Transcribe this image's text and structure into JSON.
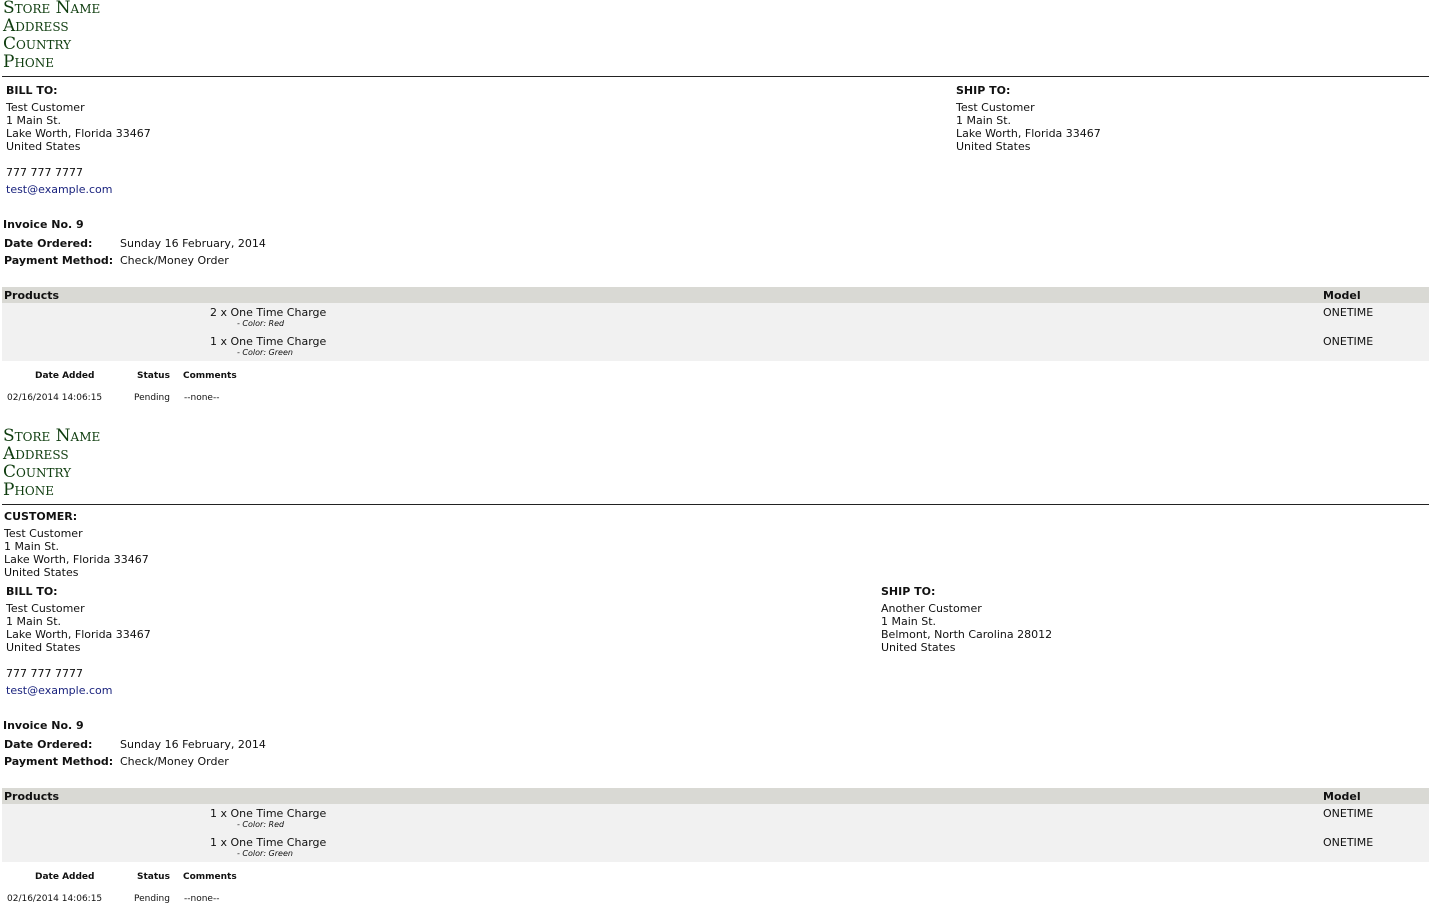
{
  "store": [
    "Store Name",
    "Address",
    "Country",
    "Phone"
  ],
  "invoices": [
    {
      "bill_to": {
        "label": "BILL TO:",
        "lines": [
          "Test Customer",
          "1 Main St.",
          "Lake Worth, Florida 33467",
          "United States"
        ],
        "phone": "777 777 7777",
        "email": "test@example.com"
      },
      "ship_to": {
        "label": "SHIP TO:",
        "lines": [
          "Test Customer",
          "1 Main St.",
          "Lake Worth, Florida 33467",
          "United States"
        ]
      },
      "invoice_no": "Invoice No. 9",
      "date_label": "Date Ordered:",
      "date_value": "Sunday 16 February, 2014",
      "payment_label": "Payment Method:",
      "payment_value": "Check/Money Order",
      "products_header": "Products",
      "model_header": "Model",
      "items": [
        {
          "line": "2 x One Time Charge",
          "attr": "- Color: Red",
          "model": "ONETIME"
        },
        {
          "line": "1 x One Time Charge",
          "attr": "- Color: Green",
          "model": "ONETIME"
        }
      ],
      "history": {
        "headers": [
          "Date Added",
          "Status",
          "Comments"
        ],
        "row": [
          "02/16/2014 14:06:15",
          "Pending",
          "--none--"
        ]
      }
    },
    {
      "customer": {
        "label": "CUSTOMER:",
        "lines": [
          "Test Customer",
          "1 Main St.",
          "Lake Worth, Florida 33467",
          "United States"
        ]
      },
      "bill_to": {
        "label": "BILL TO:",
        "lines": [
          "Test Customer",
          "1 Main St.",
          "Lake Worth, Florida 33467",
          "United States"
        ],
        "phone": "777 777 7777",
        "email": "test@example.com"
      },
      "ship_to": {
        "label": "SHIP TO:",
        "lines": [
          "Another Customer",
          "1 Main St.",
          "Belmont, North Carolina 28012",
          "United States"
        ]
      },
      "invoice_no": "Invoice No. 9",
      "date_label": "Date Ordered:",
      "date_value": "Sunday 16 February, 2014",
      "payment_label": "Payment Method:",
      "payment_value": "Check/Money Order",
      "products_header": "Products",
      "model_header": "Model",
      "items": [
        {
          "line": "1 x One Time Charge",
          "attr": "- Color: Red",
          "model": "ONETIME"
        },
        {
          "line": "1 x One Time Charge",
          "attr": "- Color: Green",
          "model": "ONETIME"
        }
      ],
      "history": {
        "headers": [
          "Date Added",
          "Status",
          "Comments"
        ],
        "row": [
          "02/16/2014 14:06:15",
          "Pending",
          "--none--"
        ]
      }
    }
  ]
}
